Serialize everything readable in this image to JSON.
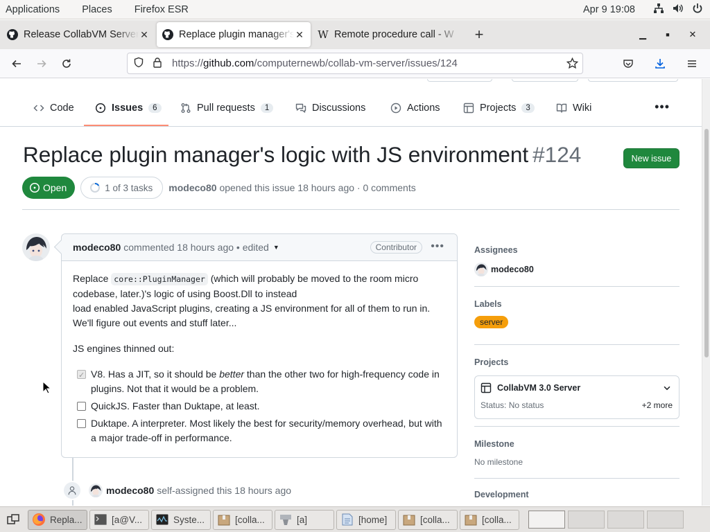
{
  "panel": {
    "applications": "Applications",
    "places": "Places",
    "app_name": "Firefox ESR",
    "clock": "Apr 9  19:08"
  },
  "tabs": [
    {
      "title": "Release CollabVM Server",
      "icon": "github-icon"
    },
    {
      "title": "Replace plugin manager's",
      "icon": "github-icon"
    },
    {
      "title": "Remote procedure call - W",
      "icon": "wikipedia-icon"
    }
  ],
  "address": {
    "prefix": "https://",
    "host": "github.com",
    "path": "/computernewb/collab-vm-server/issues/124"
  },
  "repo_nav": [
    {
      "label": "Code",
      "icon": "code-icon",
      "count": ""
    },
    {
      "label": "Issues",
      "icon": "issue-opened-icon",
      "count": "6"
    },
    {
      "label": "Pull requests",
      "icon": "git-pull-request-icon",
      "count": "1"
    },
    {
      "label": "Discussions",
      "icon": "comment-discussion-icon",
      "count": ""
    },
    {
      "label": "Actions",
      "icon": "play-icon",
      "count": ""
    },
    {
      "label": "Projects",
      "icon": "table-icon",
      "count": "3"
    },
    {
      "label": "Wiki",
      "icon": "book-icon",
      "count": ""
    }
  ],
  "issue": {
    "title": "Replace plugin manager's logic with JS environment",
    "number": "#124",
    "new_issue": "New issue",
    "state": "Open",
    "tasks": "1 of 3 tasks",
    "author": "modeco80",
    "opened_text": "opened this issue 18 hours ago · 0 comments"
  },
  "comment": {
    "author": "modeco80",
    "meta": "commented 18 hours ago • edited",
    "role": "Contributor",
    "p1_a": "Replace ",
    "p1_code": "core::PluginManager",
    "p1_b": " (which will probably be moved to the room micro codebase, later.)'s logic of using Boost.Dll to instead",
    "p1_c": "load enabled JavaScript plugins, creating a JS environment for all of them to run in. We'll figure out events and stuff later...",
    "p2": "JS engines thinned out:",
    "tasks": [
      {
        "checked": true,
        "pre": "V8. Has a JIT, so it should be ",
        "em": "better",
        "post": " than the other two for high-frequency code in plugins. Not that it would be a problem."
      },
      {
        "checked": false,
        "pre": "QuickJS. Faster than Duktape, at least.",
        "em": "",
        "post": ""
      },
      {
        "checked": false,
        "pre": "Duktape. A interpreter. Most likely the best for security/memory overhead, but with a major trade-off in performance.",
        "em": "",
        "post": ""
      }
    ]
  },
  "timeline_event": {
    "author": "modeco80",
    "text": "self-assigned this 18 hours ago"
  },
  "sidebar": {
    "assignees_label": "Assignees",
    "assignee": "modeco80",
    "labels_label": "Labels",
    "label": "server",
    "label_color": "#f59e0b",
    "projects_label": "Projects",
    "project_name": "CollabVM 3.0 Server",
    "project_status": "Status: No status",
    "project_more": "+2 more",
    "milestone_label": "Milestone",
    "milestone_value": "No milestone",
    "development_label": "Development"
  },
  "taskbar": [
    {
      "label": "Repla...",
      "icon": "firefox-icon",
      "active": true
    },
    {
      "label": "[a@V...",
      "icon": "terminal-icon",
      "active": false
    },
    {
      "label": "Syste...",
      "icon": "system-monitor-icon",
      "active": false
    },
    {
      "label": "[colla...",
      "icon": "archive-icon",
      "active": false
    },
    {
      "label": "[a]",
      "icon": "file-manager-icon",
      "active": false
    },
    {
      "label": "[home]",
      "icon": "text-editor-icon",
      "active": false
    },
    {
      "label": "[colla...",
      "icon": "archive-icon",
      "active": false
    },
    {
      "label": "[colla...",
      "icon": "archive-icon",
      "active": false
    }
  ],
  "colors": {
    "accent_green": "#1f883d",
    "tab_underline": "#fd8c73",
    "muted_text": "#656d76"
  }
}
